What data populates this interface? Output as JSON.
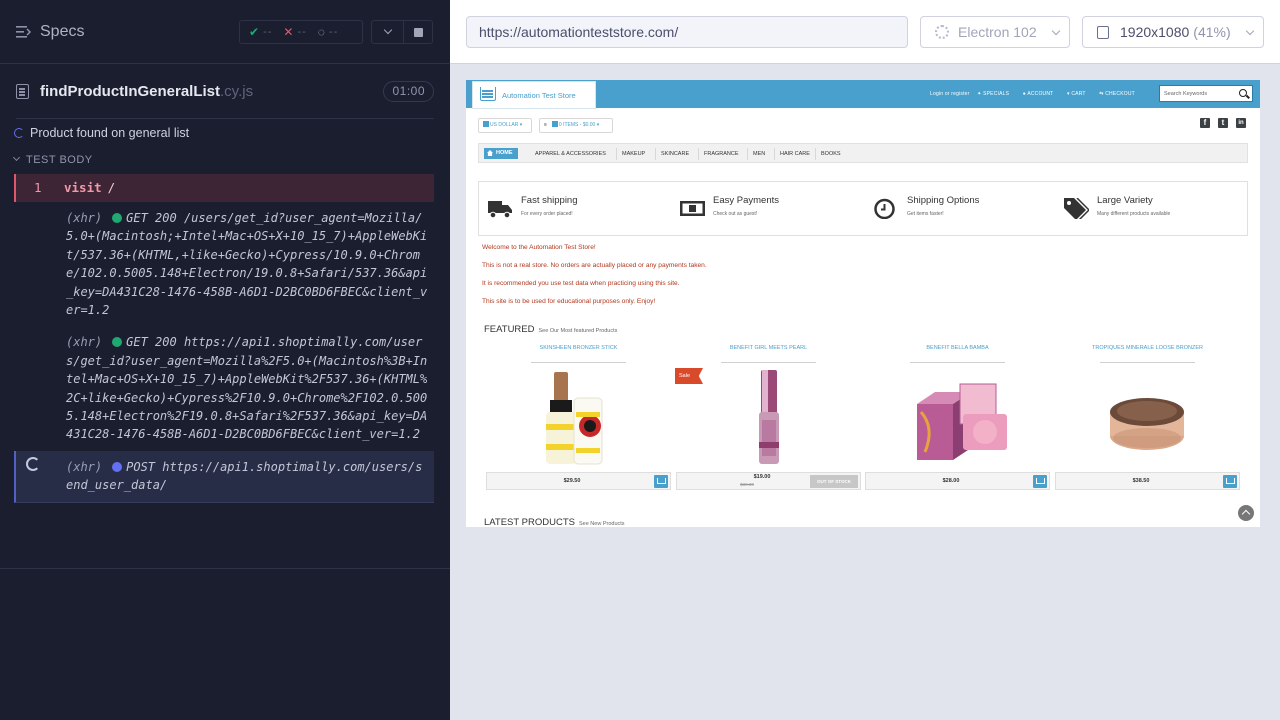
{
  "reporter": {
    "title": "Specs",
    "stats": {
      "passed": "--",
      "failed": "--",
      "pending": "--"
    },
    "spec": {
      "name": "findProductInGeneralList",
      "ext": ".cy.js",
      "duration": "01:00"
    },
    "test_title": "Product found on general list",
    "test_body_label": "TEST BODY",
    "commands": [
      {
        "number": "1",
        "name": "visit",
        "arg": "/"
      },
      {
        "label": "(xhr)",
        "method": "GET 200",
        "status_color": "#1fa971",
        "url": "/users/get_id?user_agent=Mozilla/5.0+(Macintosh;+Intel+Mac+OS+X+10_15_7)+AppleWebKit/537.36+(KHTML,+like+Gecko)+Cypress/10.9.0+Chrome/102.0.5005.148+Electron/19.0.8+Safari/537.36&api_key=DA431C28-1476-458B-A6D1-D2BC0BD6FBEC&client_ver=1.2"
      },
      {
        "label": "(xhr)",
        "method": "GET 200",
        "status_color": "#1fa971",
        "url": "https://api1.shoptimally.com/users/get_id?user_agent=Mozilla%2F5.0+(Macintosh%3B+Intel+Mac+OS+X+10_15_7)+AppleWebKit%2F537.36+(KHTML%2C+like+Gecko)+Cypress%2F10.9.0+Chrome%2F102.0.5005.148+Electron%2F19.0.8+Safari%2F537.36&api_key=DA431C28-1476-458B-A6D1-D2BC0BD6FBEC&client_ver=1.2"
      },
      {
        "label": "(xhr)",
        "method": "POST",
        "status_color": "#6470f3",
        "url": "https://api1.shoptimally.com/users/send_user_data/"
      }
    ]
  },
  "aut": {
    "url": "https://automationteststore.com/",
    "browser": "Electron 102",
    "viewport": "1920x1080",
    "scale": "(41%)"
  },
  "site": {
    "logo_text": "Automation Test Store",
    "top_links": [
      "Login or register",
      "SPECIALS",
      "ACCOUNT",
      "CART",
      "CHECKOUT"
    ],
    "search_placeholder": "Search Keywords",
    "currency": "US DOLLAR",
    "cart_items": "0 ITEMS - $0.00",
    "social": [
      "f",
      "t",
      "in"
    ],
    "nav": [
      "HOME",
      "APPAREL & ACCESSORIES",
      "MAKEUP",
      "SKINCARE",
      "FRAGRANCE",
      "MEN",
      "HAIR CARE",
      "BOOKS"
    ],
    "features": [
      {
        "title": "Fast shipping",
        "subtitle": "For every order placed!",
        "icon": "truck-icon"
      },
      {
        "title": "Easy Payments",
        "subtitle": "Check out as guest!",
        "icon": "money-icon"
      },
      {
        "title": "Shipping Options",
        "subtitle": "Get items faster!",
        "icon": "clock-icon"
      },
      {
        "title": "Large Variety",
        "subtitle": "Many different products available",
        "icon": "tags-icon"
      }
    ],
    "welcome_lines": [
      "Welcome to the Automation Test Store!",
      "This is not a real store. No orders are actually placed or any payments taken.",
      "It is recommended you use test data when practicing using this site.",
      "This site is to be used for educational purposes only. Enjoy!"
    ],
    "featured": {
      "title": "FEATURED",
      "subtitle": "See Our Most featured Products"
    },
    "products": [
      {
        "name": "SKINSHEEN BRONZER STICK",
        "price": "$29.50",
        "old_price": "",
        "in_stock": true
      },
      {
        "name": "BENEFIT GIRL MEETS PEARL",
        "price": "$19.00",
        "old_price": "$30.00",
        "in_stock": false,
        "stock_label": "OUT OF STOCK",
        "sale": "Sale"
      },
      {
        "name": "BENEFIT BELLA BAMBA",
        "price": "$28.00",
        "old_price": "",
        "in_stock": true
      },
      {
        "name": "TROPIQUES MINERALE LOOSE BRONZER",
        "price": "$38.50",
        "old_price": "",
        "in_stock": true
      }
    ],
    "latest": {
      "title": "LATEST PRODUCTS",
      "subtitle": "See New Products"
    }
  }
}
